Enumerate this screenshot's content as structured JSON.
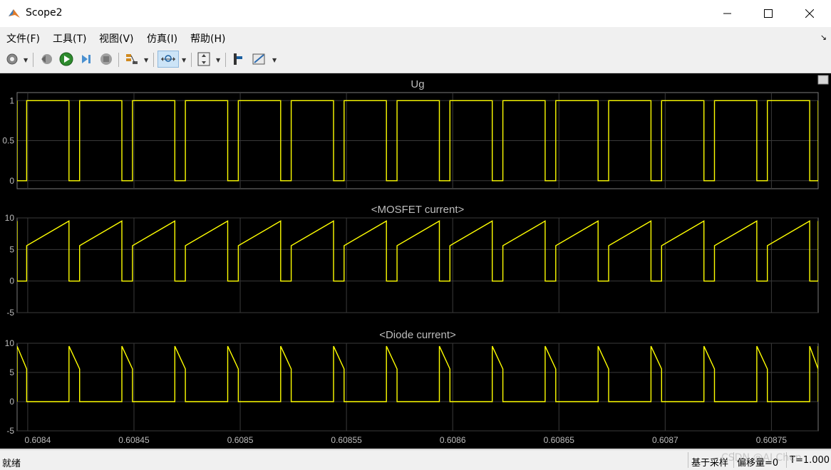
{
  "window": {
    "title": "Scope2"
  },
  "menu": [
    {
      "label": "文件(F)"
    },
    {
      "label": "工具(T)"
    },
    {
      "label": "视图(V)"
    },
    {
      "label": "仿真(I)"
    },
    {
      "label": "帮助(H)"
    }
  ],
  "toolbar": {
    "items": [
      "gear-icon",
      "step-back-icon",
      "run-icon",
      "step-forward-icon",
      "stop-icon",
      "signal-selector-icon",
      "zoom-icon",
      "autoscale-icon",
      "measure-cursor-icon",
      "style-icon"
    ]
  },
  "x_ticks": [
    "0.6084",
    "0.60845",
    "0.6085",
    "0.60855",
    "0.6086",
    "0.60865",
    "0.6087",
    "0.60875"
  ],
  "chart_data": [
    {
      "type": "line",
      "title": "Ug",
      "ylim": [
        -0.1,
        1.1
      ],
      "yticks": [
        "1",
        "0.5",
        "0"
      ],
      "grid": true,
      "series": [
        {
          "values_description_level": [
            0,
            1
          ]
        }
      ]
    },
    {
      "type": "line",
      "title": "<MOSFET current>",
      "ylim": [
        -5,
        10
      ],
      "yticks": [
        "10",
        "5",
        "0",
        "-5"
      ],
      "grid": true,
      "ramp": {
        "start": 5.6,
        "end": 9.5,
        "off": 0
      }
    },
    {
      "type": "line",
      "title": "<Diode current>",
      "ylim": [
        -5,
        10
      ],
      "yticks": [
        "10",
        "5",
        "0",
        "-5"
      ],
      "grid": true,
      "ramp": {
        "start": 9.5,
        "end": 5.6,
        "off": 0
      }
    }
  ],
  "signal": {
    "period": 2.49e-05,
    "duty": 0.8,
    "xlim": [
      0.608395,
      0.608772
    ],
    "first_rise": 0.6083995,
    "color": "#ffff00"
  },
  "status": {
    "left": "就绪",
    "sample_based": "基于采样",
    "offset": "偏移量=0",
    "time": "T=1.000",
    "watermark": "CSDN @AI Chen"
  }
}
